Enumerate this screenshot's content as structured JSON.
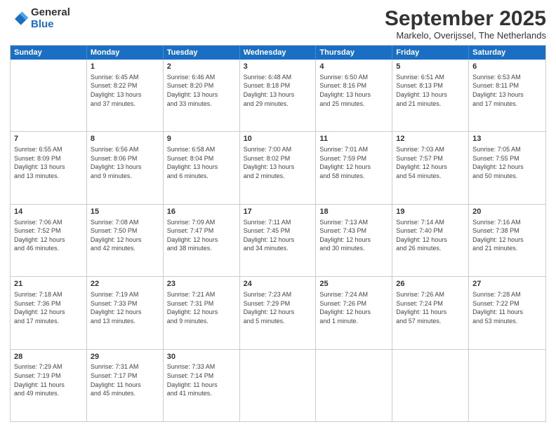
{
  "logo": {
    "general": "General",
    "blue": "Blue"
  },
  "title": "September 2025",
  "location": "Markelo, Overijssel, The Netherlands",
  "header_days": [
    "Sunday",
    "Monday",
    "Tuesday",
    "Wednesday",
    "Thursday",
    "Friday",
    "Saturday"
  ],
  "weeks": [
    [
      {
        "day": "",
        "info": ""
      },
      {
        "day": "1",
        "info": "Sunrise: 6:45 AM\nSunset: 8:22 PM\nDaylight: 13 hours\nand 37 minutes."
      },
      {
        "day": "2",
        "info": "Sunrise: 6:46 AM\nSunset: 8:20 PM\nDaylight: 13 hours\nand 33 minutes."
      },
      {
        "day": "3",
        "info": "Sunrise: 6:48 AM\nSunset: 8:18 PM\nDaylight: 13 hours\nand 29 minutes."
      },
      {
        "day": "4",
        "info": "Sunrise: 6:50 AM\nSunset: 8:16 PM\nDaylight: 13 hours\nand 25 minutes."
      },
      {
        "day": "5",
        "info": "Sunrise: 6:51 AM\nSunset: 8:13 PM\nDaylight: 13 hours\nand 21 minutes."
      },
      {
        "day": "6",
        "info": "Sunrise: 6:53 AM\nSunset: 8:11 PM\nDaylight: 13 hours\nand 17 minutes."
      }
    ],
    [
      {
        "day": "7",
        "info": "Sunrise: 6:55 AM\nSunset: 8:09 PM\nDaylight: 13 hours\nand 13 minutes."
      },
      {
        "day": "8",
        "info": "Sunrise: 6:56 AM\nSunset: 8:06 PM\nDaylight: 13 hours\nand 9 minutes."
      },
      {
        "day": "9",
        "info": "Sunrise: 6:58 AM\nSunset: 8:04 PM\nDaylight: 13 hours\nand 6 minutes."
      },
      {
        "day": "10",
        "info": "Sunrise: 7:00 AM\nSunset: 8:02 PM\nDaylight: 13 hours\nand 2 minutes."
      },
      {
        "day": "11",
        "info": "Sunrise: 7:01 AM\nSunset: 7:59 PM\nDaylight: 12 hours\nand 58 minutes."
      },
      {
        "day": "12",
        "info": "Sunrise: 7:03 AM\nSunset: 7:57 PM\nDaylight: 12 hours\nand 54 minutes."
      },
      {
        "day": "13",
        "info": "Sunrise: 7:05 AM\nSunset: 7:55 PM\nDaylight: 12 hours\nand 50 minutes."
      }
    ],
    [
      {
        "day": "14",
        "info": "Sunrise: 7:06 AM\nSunset: 7:52 PM\nDaylight: 12 hours\nand 46 minutes."
      },
      {
        "day": "15",
        "info": "Sunrise: 7:08 AM\nSunset: 7:50 PM\nDaylight: 12 hours\nand 42 minutes."
      },
      {
        "day": "16",
        "info": "Sunrise: 7:09 AM\nSunset: 7:47 PM\nDaylight: 12 hours\nand 38 minutes."
      },
      {
        "day": "17",
        "info": "Sunrise: 7:11 AM\nSunset: 7:45 PM\nDaylight: 12 hours\nand 34 minutes."
      },
      {
        "day": "18",
        "info": "Sunrise: 7:13 AM\nSunset: 7:43 PM\nDaylight: 12 hours\nand 30 minutes."
      },
      {
        "day": "19",
        "info": "Sunrise: 7:14 AM\nSunset: 7:40 PM\nDaylight: 12 hours\nand 26 minutes."
      },
      {
        "day": "20",
        "info": "Sunrise: 7:16 AM\nSunset: 7:38 PM\nDaylight: 12 hours\nand 21 minutes."
      }
    ],
    [
      {
        "day": "21",
        "info": "Sunrise: 7:18 AM\nSunset: 7:36 PM\nDaylight: 12 hours\nand 17 minutes."
      },
      {
        "day": "22",
        "info": "Sunrise: 7:19 AM\nSunset: 7:33 PM\nDaylight: 12 hours\nand 13 minutes."
      },
      {
        "day": "23",
        "info": "Sunrise: 7:21 AM\nSunset: 7:31 PM\nDaylight: 12 hours\nand 9 minutes."
      },
      {
        "day": "24",
        "info": "Sunrise: 7:23 AM\nSunset: 7:29 PM\nDaylight: 12 hours\nand 5 minutes."
      },
      {
        "day": "25",
        "info": "Sunrise: 7:24 AM\nSunset: 7:26 PM\nDaylight: 12 hours\nand 1 minute."
      },
      {
        "day": "26",
        "info": "Sunrise: 7:26 AM\nSunset: 7:24 PM\nDaylight: 11 hours\nand 57 minutes."
      },
      {
        "day": "27",
        "info": "Sunrise: 7:28 AM\nSunset: 7:22 PM\nDaylight: 11 hours\nand 53 minutes."
      }
    ],
    [
      {
        "day": "28",
        "info": "Sunrise: 7:29 AM\nSunset: 7:19 PM\nDaylight: 11 hours\nand 49 minutes."
      },
      {
        "day": "29",
        "info": "Sunrise: 7:31 AM\nSunset: 7:17 PM\nDaylight: 11 hours\nand 45 minutes."
      },
      {
        "day": "30",
        "info": "Sunrise: 7:33 AM\nSunset: 7:14 PM\nDaylight: 11 hours\nand 41 minutes."
      },
      {
        "day": "",
        "info": ""
      },
      {
        "day": "",
        "info": ""
      },
      {
        "day": "",
        "info": ""
      },
      {
        "day": "",
        "info": ""
      }
    ]
  ]
}
